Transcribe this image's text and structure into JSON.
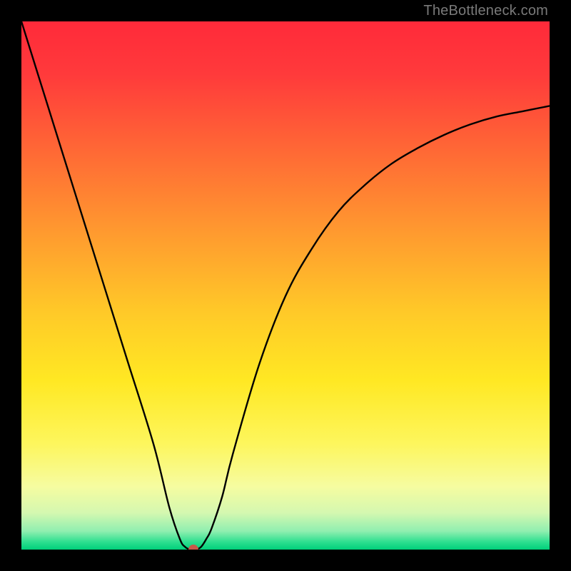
{
  "watermark": "TheBottleneck.com",
  "chart_data": {
    "type": "line",
    "title": "",
    "xlabel": "",
    "ylabel": "",
    "xlim": [
      0,
      100
    ],
    "ylim": [
      0,
      100
    ],
    "series": [
      {
        "name": "bottleneck-curve",
        "x": [
          0,
          5,
          10,
          15,
          20,
          25,
          28,
          30,
          31,
          32,
          33,
          34,
          35,
          36,
          38,
          40,
          45,
          50,
          55,
          60,
          65,
          70,
          75,
          80,
          85,
          90,
          95,
          100
        ],
        "values": [
          100,
          84,
          68,
          52,
          36,
          20,
          8,
          2,
          0.5,
          0,
          0,
          0.5,
          2,
          4,
          10,
          18,
          35,
          48,
          57,
          64,
          69,
          73,
          76,
          78.5,
          80.5,
          82,
          83,
          84
        ]
      }
    ],
    "marker": {
      "x": 32.5,
      "y": 0
    },
    "gradient_stops": [
      {
        "offset": 0.0,
        "color": "#ff2a3a"
      },
      {
        "offset": 0.1,
        "color": "#ff3a3b"
      },
      {
        "offset": 0.25,
        "color": "#ff6a35"
      },
      {
        "offset": 0.4,
        "color": "#ff9a2f"
      },
      {
        "offset": 0.55,
        "color": "#ffc928"
      },
      {
        "offset": 0.68,
        "color": "#ffe823"
      },
      {
        "offset": 0.8,
        "color": "#fdf65d"
      },
      {
        "offset": 0.88,
        "color": "#f6fca0"
      },
      {
        "offset": 0.93,
        "color": "#d5f8b0"
      },
      {
        "offset": 0.965,
        "color": "#90efb0"
      },
      {
        "offset": 0.985,
        "color": "#2fe090"
      },
      {
        "offset": 1.0,
        "color": "#00d07a"
      }
    ]
  }
}
